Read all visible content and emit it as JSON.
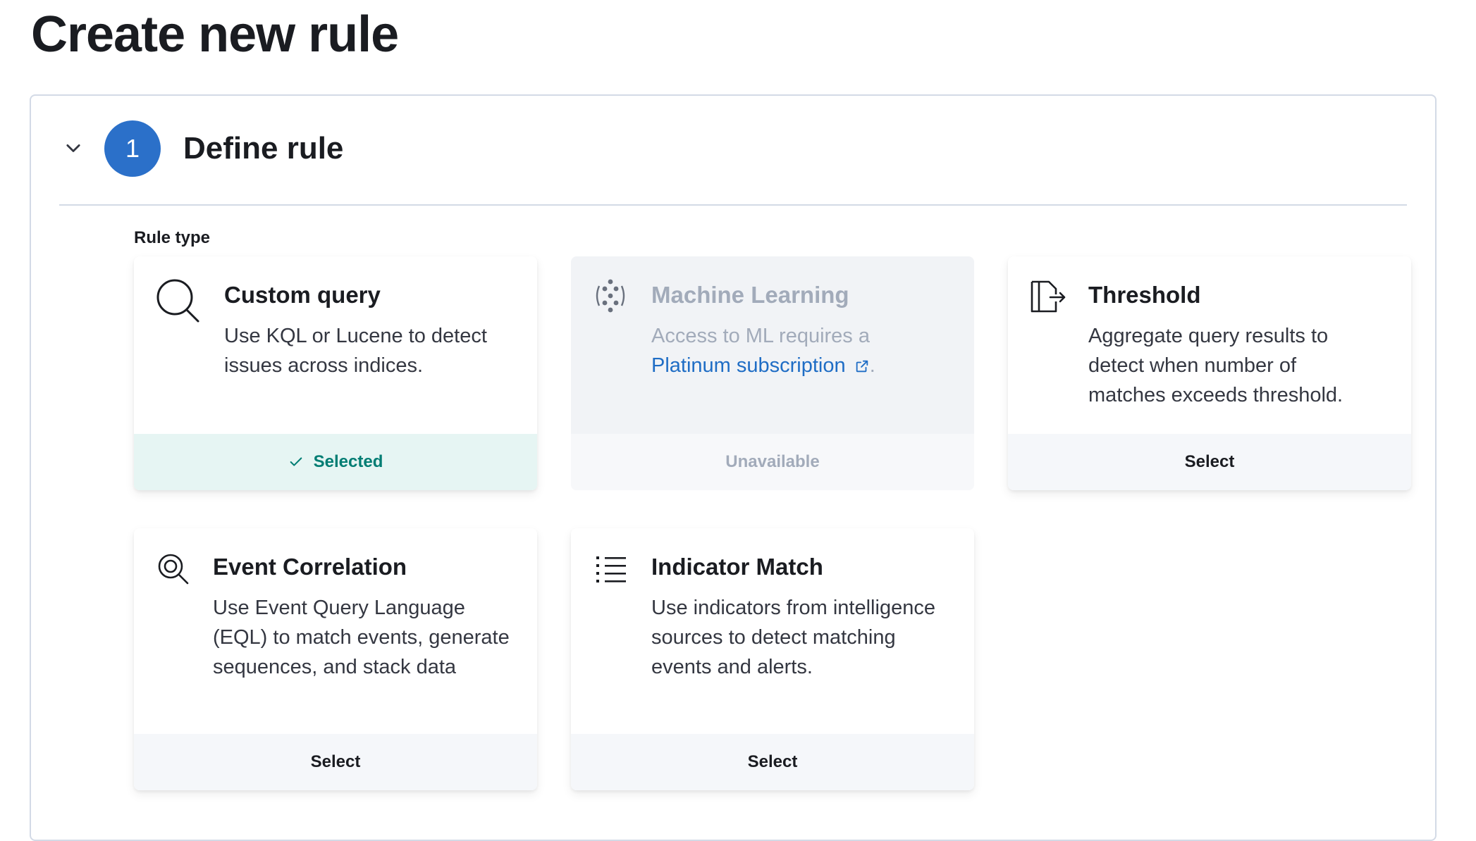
{
  "page": {
    "title": "Create new rule"
  },
  "step": {
    "number": "1",
    "title": "Define rule",
    "toggle_icon": "chevron-down-icon"
  },
  "rule_type": {
    "label": "Rule type",
    "cards": [
      {
        "id": "custom-query",
        "icon": "search-icon",
        "title": "Custom query",
        "description": "Use KQL or Lucene to detect issues across indices.",
        "footer": "Selected",
        "state": "selected"
      },
      {
        "id": "machine-learning",
        "icon": "ml-icon",
        "title": "Machine Learning",
        "description_prefix": "Access to ML requires a",
        "link": "Platinum subscription",
        "link_suffix": ".",
        "footer": "Unavailable",
        "state": "disabled"
      },
      {
        "id": "threshold",
        "icon": "threshold-icon",
        "title": "Threshold",
        "description": "Aggregate query results to detect when number of matches exceeds threshold.",
        "footer": "Select",
        "state": "default"
      },
      {
        "id": "event-correlation",
        "icon": "eql-icon",
        "title": "Event Correlation",
        "description": "Use Event Query Language (EQL) to match events, generate sequences, and stack data",
        "footer": "Select",
        "state": "default"
      },
      {
        "id": "indicator-match",
        "icon": "list-icon",
        "title": "Indicator Match",
        "description": "Use indicators from intelligence sources to detect matching events and alerts.",
        "footer": "Select",
        "state": "default"
      }
    ]
  },
  "colors": {
    "accent": "#2b70c9",
    "selected_bg": "#e6f5f3",
    "selected_text": "#017d73",
    "link": "#1f6dc5"
  }
}
